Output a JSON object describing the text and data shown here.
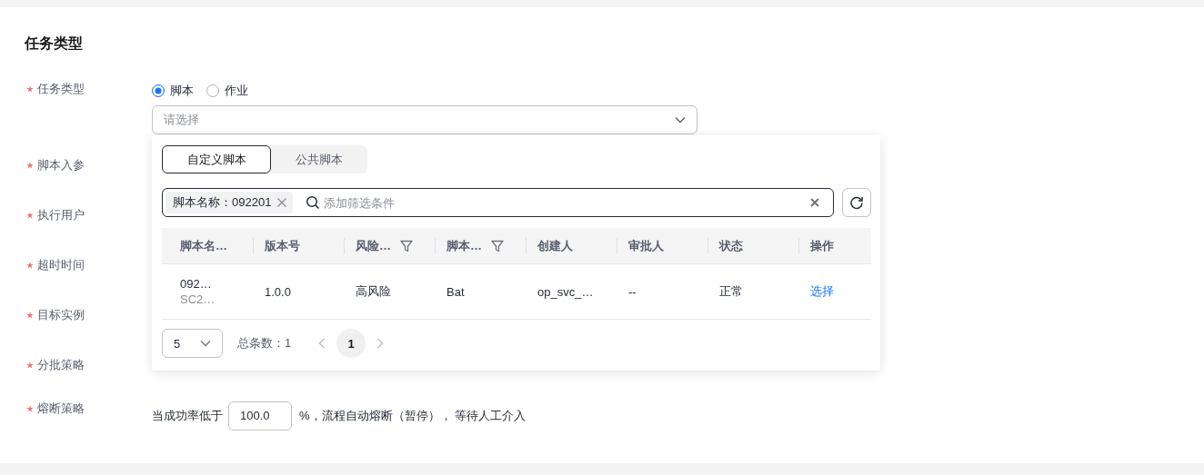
{
  "section_title": "任务类型",
  "fields": [
    {
      "label": "任务类型",
      "required": true,
      "kind": "type-select",
      "options": [
        {
          "label": "脚本",
          "selected": true
        },
        {
          "label": "作业",
          "selected": false
        }
      ],
      "select": {
        "placeholder": "请选择"
      }
    },
    {
      "label": "脚本入参",
      "required": true,
      "kind": "covered"
    },
    {
      "label": "执行用户",
      "required": true,
      "kind": "covered"
    },
    {
      "label": "超时时间",
      "required": true,
      "kind": "covered"
    },
    {
      "label": "目标实例",
      "required": true,
      "kind": "covered"
    },
    {
      "label": "分批策略",
      "required": true,
      "kind": "covered"
    },
    {
      "label": "熔断策略",
      "required": true,
      "kind": "threshold",
      "prefix": "当成功率低于",
      "value": "100.0",
      "suffix": "%，流程自动熔断（暂停），  等待人工介入"
    }
  ],
  "popup": {
    "tabs": [
      {
        "label": "自定义脚本",
        "selected": true
      },
      {
        "label": "公共脚本",
        "selected": false
      }
    ],
    "filter": {
      "chip": "脚本名称：092201",
      "placeholder": "添加筛选条件"
    },
    "table": {
      "columns": [
        {
          "label": "脚本名…",
          "filter": false
        },
        {
          "label": "版本号",
          "filter": false
        },
        {
          "label": "风险…",
          "filter": true
        },
        {
          "label": "脚本…",
          "filter": true
        },
        {
          "label": "创建人",
          "filter": false
        },
        {
          "label": "审批人",
          "filter": false
        },
        {
          "label": "状态",
          "filter": false
        },
        {
          "label": "操作",
          "filter": false
        }
      ],
      "rows": [
        {
          "cells": [
            {
              "kind": "stack",
              "lines": [
                "092…",
                "SC2…"
              ]
            },
            {
              "kind": "text",
              "text": "1.0.0"
            },
            {
              "kind": "text",
              "text": "高风险"
            },
            {
              "kind": "text",
              "text": "Bat"
            },
            {
              "kind": "text",
              "text": "op_svc_…"
            },
            {
              "kind": "text",
              "text": "--"
            },
            {
              "kind": "text",
              "text": "正常"
            },
            {
              "kind": "link",
              "text": "选择"
            }
          ]
        }
      ]
    },
    "pagination": {
      "page_size": "5",
      "total": "总条数：1",
      "pages": [
        {
          "label": "1",
          "selected": true
        }
      ]
    }
  }
}
